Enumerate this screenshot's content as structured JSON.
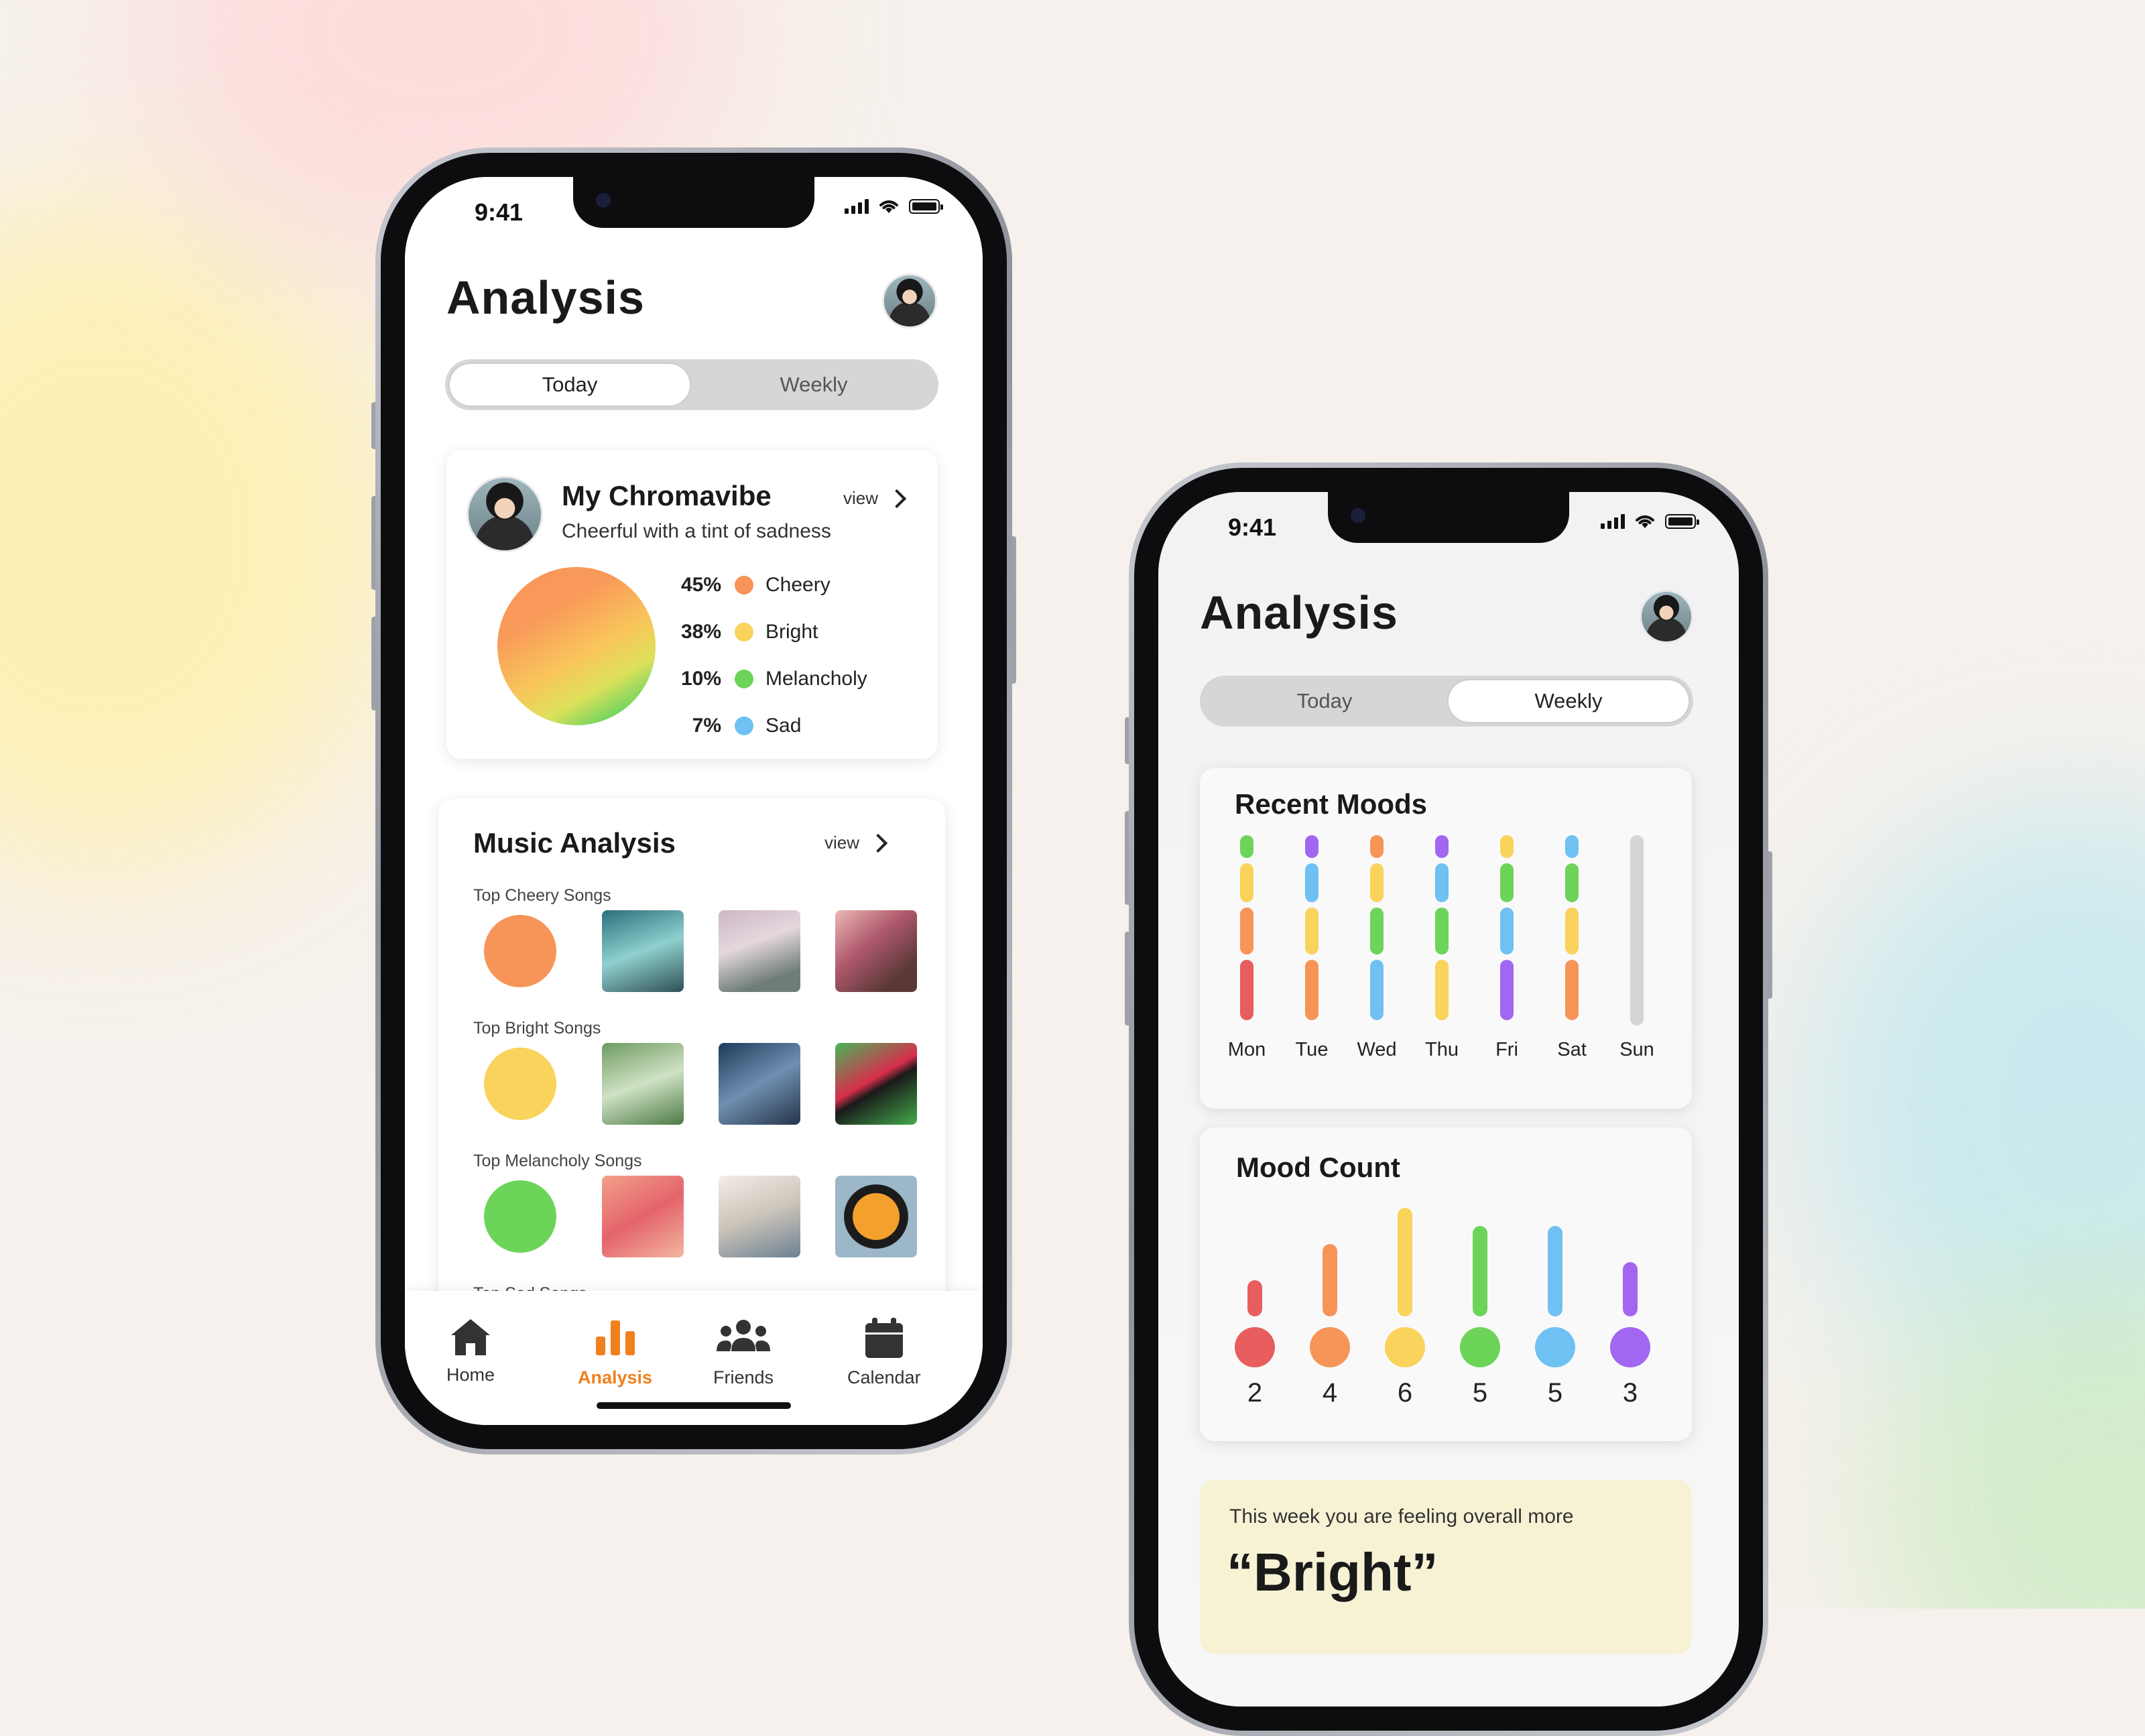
{
  "colors": {
    "cheery": "#f79457",
    "bright": "#f9d35b",
    "melancholy": "#6dd45a",
    "sad": "#6ec1f2",
    "angry": "#e85d5d",
    "moody": "#a266f0",
    "accent": "#f0801e"
  },
  "phone_today": {
    "status_time": "9:41",
    "title": "Analysis",
    "tabs": {
      "today": "Today",
      "weekly": "Weekly"
    },
    "chromavibe": {
      "title": "My Chromavibe",
      "subtitle": "Cheerful with a tint of sadness",
      "view": "view",
      "legend": [
        {
          "pct": "45%",
          "label": "Cheery",
          "color": "#f79457"
        },
        {
          "pct": "38%",
          "label": "Bright",
          "color": "#f9d35b"
        },
        {
          "pct": "10%",
          "label": "Melancholy",
          "color": "#6dd45a"
        },
        {
          "pct": "7%",
          "label": "Sad",
          "color": "#6ec1f2"
        }
      ]
    },
    "music": {
      "title": "Music Analysis",
      "view": "view",
      "rows": [
        {
          "label": "Top Cheery Songs",
          "color": "#f79457"
        },
        {
          "label": "Top Bright Songs",
          "color": "#f9d35b"
        },
        {
          "label": "Top Melancholy Songs",
          "color": "#6dd45a"
        },
        {
          "label": "Top Sad Songs",
          "color": "#6ec1f2"
        }
      ]
    },
    "tabbar": {
      "home": "Home",
      "analysis": "Analysis",
      "friends": "Friends",
      "calendar": "Calendar"
    }
  },
  "phone_weekly": {
    "status_time": "9:41",
    "title": "Analysis",
    "tabs": {
      "today": "Today",
      "weekly": "Weekly"
    },
    "recent_moods": {
      "title": "Recent Moods",
      "days": [
        {
          "label": "Mon",
          "segments": [
            "#6dd45a",
            "#f9d35b",
            "#f79457",
            "#e85d5d"
          ]
        },
        {
          "label": "Tue",
          "segments": [
            "#a266f0",
            "#6ec1f2",
            "#f9d35b",
            "#f79457"
          ]
        },
        {
          "label": "Wed",
          "segments": [
            "#f79457",
            "#f9d35b",
            "#6dd45a",
            "#6ec1f2"
          ]
        },
        {
          "label": "Thu",
          "segments": [
            "#a266f0",
            "#6ec1f2",
            "#6dd45a",
            "#f9d35b"
          ]
        },
        {
          "label": "Fri",
          "segments": [
            "#f9d35b",
            "#6dd45a",
            "#6ec1f2",
            "#a266f0"
          ]
        },
        {
          "label": "Sat",
          "segments": [
            "#6ec1f2",
            "#6dd45a",
            "#f9d35b",
            "#f79457"
          ]
        },
        {
          "label": "Sun",
          "segments": []
        }
      ]
    },
    "mood_count": {
      "title": "Mood Count",
      "items": [
        {
          "count": "2",
          "value": 2,
          "color": "#e85d5d"
        },
        {
          "count": "4",
          "value": 4,
          "color": "#f79457"
        },
        {
          "count": "6",
          "value": 6,
          "color": "#f9d35b"
        },
        {
          "count": "5",
          "value": 5,
          "color": "#6dd45a"
        },
        {
          "count": "5",
          "value": 5,
          "color": "#6ec1f2"
        },
        {
          "count": "3",
          "value": 3,
          "color": "#a266f0"
        }
      ]
    },
    "summary": {
      "text": "This week you are feeling overall more",
      "mood": "“Bright”"
    }
  }
}
